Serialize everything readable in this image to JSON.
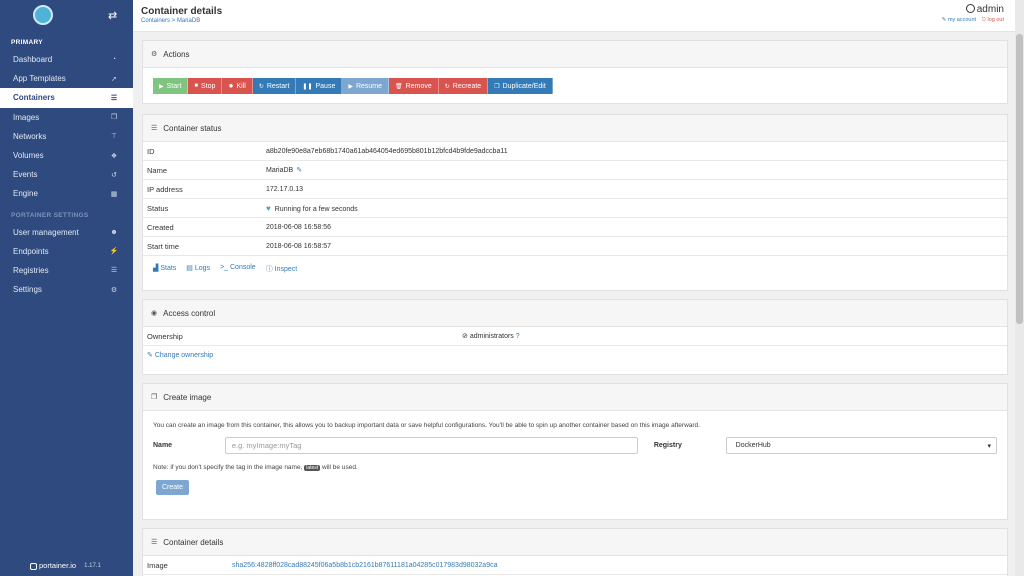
{
  "sidebar": {
    "section_primary": "PRIMARY",
    "section_settings": "PORTAINER SETTINGS",
    "items_primary": [
      {
        "label": "Dashboard",
        "icon": "tachometer-icon",
        "glyph": "◔"
      },
      {
        "label": "App Templates",
        "icon": "rocket-icon",
        "glyph": "➚"
      },
      {
        "label": "Containers",
        "icon": "server-icon",
        "glyph": "☰"
      },
      {
        "label": "Images",
        "icon": "clone-icon",
        "glyph": "❐"
      },
      {
        "label": "Networks",
        "icon": "sitemap-icon",
        "glyph": "⊤"
      },
      {
        "label": "Volumes",
        "icon": "cubes-icon",
        "glyph": "❖"
      },
      {
        "label": "Events",
        "icon": "history-icon",
        "glyph": "↺"
      },
      {
        "label": "Engine",
        "icon": "th-icon",
        "glyph": "▦"
      }
    ],
    "items_settings": [
      {
        "label": "User management",
        "icon": "users-icon",
        "glyph": "☻"
      },
      {
        "label": "Endpoints",
        "icon": "plug-icon",
        "glyph": "⚡"
      },
      {
        "label": "Registries",
        "icon": "database-icon",
        "glyph": "☰"
      },
      {
        "label": "Settings",
        "icon": "cogs-icon",
        "glyph": "⚙"
      }
    ],
    "footer": {
      "brand": "portainer.io",
      "version": "1.17.1"
    }
  },
  "header": {
    "title": "Container details",
    "breadcrumb": "Containers > MariaDB",
    "user": "admin",
    "my_account": "my account",
    "log_out": "log out"
  },
  "actions": {
    "title": "Actions",
    "buttons": [
      {
        "label": "Start",
        "glyph": "▶",
        "color": "#7fc47f"
      },
      {
        "label": "Stop",
        "glyph": "■",
        "color": "#d9534f"
      },
      {
        "label": "Kill",
        "glyph": "✹",
        "color": "#d9534f"
      },
      {
        "label": "Restart",
        "glyph": "↻",
        "color": "#337ab7"
      },
      {
        "label": "Pause",
        "glyph": "❚❚",
        "color": "#337ab7"
      },
      {
        "label": "Resume",
        "glyph": "▶",
        "color": "#7da7d0"
      },
      {
        "label": "Remove",
        "glyph": "🗑",
        "color": "#d9534f"
      },
      {
        "label": "Recreate",
        "glyph": "↻",
        "color": "#d9534f"
      },
      {
        "label": "Duplicate/Edit",
        "glyph": "❐",
        "color": "#337ab7"
      }
    ]
  },
  "status": {
    "title": "Container status",
    "rows": {
      "id": {
        "key": "ID",
        "value": "a8b20fe90e8a7eb68b1740a61ab464054ed695b801b12bfcd4b9fde9adccba11"
      },
      "name": {
        "key": "Name",
        "value": "MariaDB"
      },
      "ip": {
        "key": "IP address",
        "value": "172.17.0.13"
      },
      "status": {
        "key": "Status",
        "value": "Running for a few seconds"
      },
      "created": {
        "key": "Created",
        "value": "2018-06-08 16:58:56"
      },
      "start": {
        "key": "Start time",
        "value": "2018-06-08 16:58:57"
      }
    },
    "links": {
      "stats": "Stats",
      "logs": "Logs",
      "console": "Console",
      "inspect": "Inspect"
    }
  },
  "access": {
    "title": "Access control",
    "ownership_key": "Ownership",
    "ownership_value": "administrators",
    "change": "Change ownership"
  },
  "create_image": {
    "title": "Create image",
    "description": "You can create an image from this container, this allows you to backup important data or save helpful configurations. You'll be able to spin up another container based on this image afterward.",
    "name_label": "Name",
    "name_placeholder": "e.g. myImage:myTag",
    "registry_label": "Registry",
    "registry_value": "DockerHub",
    "note_before": "Note: if you don't specify the tag in the image name,",
    "note_tag": "latest",
    "note_after": "will be used.",
    "create_button": "Create"
  },
  "details": {
    "title": "Container details",
    "image_key": "Image",
    "image_value": "sha256:4828ff028cad88245f06a5b8b1cb2161b87611181a04285c017983d98032a9ca"
  }
}
